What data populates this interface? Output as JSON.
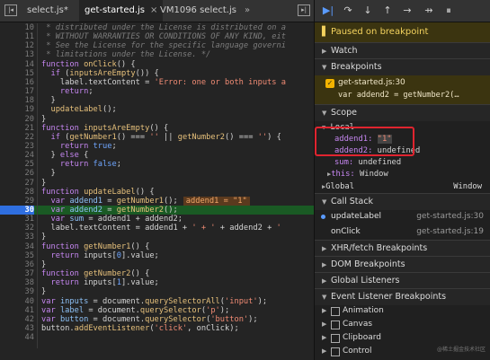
{
  "tabs": [
    {
      "label": "select.js*"
    },
    {
      "label": "get-started.js",
      "close": "×"
    },
    {
      "label": "VM1096 select.js"
    }
  ],
  "tabs_more": "»",
  "editor": {
    "lines": [
      {
        "n": "10",
        "html": "<span class='cm'> * distributed under the License is distributed on a</span>"
      },
      {
        "n": "11",
        "html": "<span class='cm'> * WITHOUT WARRANTIES OR CONDITIONS OF ANY KIND, eit</span>"
      },
      {
        "n": "12",
        "html": "<span class='cm'> * See the License for the specific language governi</span>"
      },
      {
        "n": "13",
        "html": "<span class='cm'> * limitations under the License. */</span>"
      },
      {
        "n": "14",
        "html": "<span class='kw'>function</span> <span class='fn'>onClick</span>() {"
      },
      {
        "n": "15",
        "html": "  <span class='kw'>if</span> (<span class='fn'>inputsAreEmpty</span>()) {"
      },
      {
        "n": "16",
        "html": "    label.textContent = <span class='st'>'Error: one or both inputs a</span>"
      },
      {
        "n": "17",
        "html": "    <span class='kw'>return</span>;"
      },
      {
        "n": "18",
        "html": "  }"
      },
      {
        "n": "19",
        "html": "  <span class='fn'>updateLabel</span>();"
      },
      {
        "n": "20",
        "html": "}"
      },
      {
        "n": "21",
        "html": "<span class='kw'>function</span> <span class='fn'>inputsAreEmpty</span>() {"
      },
      {
        "n": "22",
        "html": "  <span class='kw'>if</span> (<span class='fn'>getNumber1</span>() === <span class='st'>''</span> || <span class='fn'>getNumber2</span>() === <span class='st'>''</span>) {"
      },
      {
        "n": "23",
        "html": "    <span class='kw'>return</span> <span class='kw2'>true</span>;"
      },
      {
        "n": "24",
        "html": "  } <span class='kw'>else</span> {"
      },
      {
        "n": "25",
        "html": "    <span class='kw'>return</span> <span class='kw2'>false</span>;"
      },
      {
        "n": "26",
        "html": "  }"
      },
      {
        "n": "27",
        "html": "}"
      },
      {
        "n": "28",
        "html": "<span class='kw'>function</span> <span class='fn'>updateLabel</span>() {"
      },
      {
        "n": "29",
        "html": "  <span class='kw'>var</span> <span class='vr'>addend1</span> = <span class='fn'>getNumber1</span>();<span class='inl'>addend1 = \"1\"</span>"
      },
      {
        "n": "30",
        "html": "  <span class='kw'>var</span> <span class='vr'>addend2</span> = <span class='fn'>getNumber2</span>();",
        "highlight": true
      },
      {
        "n": "31",
        "html": "  <span class='kw'>var</span> <span class='vr'>sum</span> = addend1 + addend2;"
      },
      {
        "n": "32",
        "html": "  label.textContent = addend1 + <span class='st'>' + '</span> + addend2 + <span class='st'>'</span>"
      },
      {
        "n": "33",
        "html": "}"
      },
      {
        "n": "34",
        "html": "<span class='kw'>function</span> <span class='fn'>getNumber1</span>() {"
      },
      {
        "n": "35",
        "html": "  <span class='kw'>return</span> inputs[<span class='kw2'>0</span>].value;"
      },
      {
        "n": "36",
        "html": "}"
      },
      {
        "n": "37",
        "html": "<span class='kw'>function</span> <span class='fn'>getNumber2</span>() {"
      },
      {
        "n": "38",
        "html": "  <span class='kw'>return</span> inputs[<span class='kw2'>1</span>].value;"
      },
      {
        "n": "39",
        "html": "}"
      },
      {
        "n": "40",
        "html": "<span class='kw'>var</span> <span class='vr'>inputs</span> = document.<span class='fn'>querySelectorAll</span>(<span class='st'>'input'</span>);"
      },
      {
        "n": "41",
        "html": "<span class='kw'>var</span> <span class='vr'>label</span> = document.<span class='fn'>querySelector</span>(<span class='st'>'p'</span>);"
      },
      {
        "n": "42",
        "html": "<span class='kw'>var</span> <span class='vr'>button</span> = document.<span class='fn'>querySelector</span>(<span class='st'>'button'</span>);"
      },
      {
        "n": "43",
        "html": "button.<span class='fn'>addEventListener</span>(<span class='st'>'click'</span>, onClick);"
      },
      {
        "n": "44",
        "html": ""
      }
    ]
  },
  "debugger": {
    "toolbar_icons": [
      "resume-icon",
      "step-over-icon",
      "step-into-icon",
      "step-out-icon",
      "step-icon",
      "deactivate-breakpoints-icon",
      "pause-on-exceptions-icon"
    ],
    "paused_text": "Paused on breakpoint",
    "watch": "Watch",
    "breakpoints": "Breakpoints",
    "bp_file": "get-started.js:30",
    "bp_code": "var addend2 = getNumber2(…",
    "scope": "Scope",
    "local": "Local",
    "addend1_key": "addend1:",
    "addend1_val": "\"1\"",
    "addend2_key": "addend2:",
    "addend2_val": "undefined",
    "sum_key": "sum:",
    "sum_val": "undefined",
    "this_key": "this:",
    "this_val": "Window",
    "global": "Global",
    "global_val": "Window",
    "call_stack": "Call Stack",
    "cs1_name": "updateLabel",
    "cs1_file": "get-started.js:30",
    "cs2_name": "onClick",
    "cs2_file": "get-started.js:19",
    "xhr": "XHR/fetch Breakpoints",
    "dom": "DOM Breakpoints",
    "global_listeners": "Global Listeners",
    "event_listener": "Event Listener Breakpoints",
    "events": [
      "Animation",
      "Canvas",
      "Clipboard",
      "Control"
    ],
    "watermark": "@稀土掘金技术社区"
  },
  "colors": {
    "highlight_line": "#1a5a24",
    "current_line_number": "#2f6fe0",
    "paused_bg": "#3b3410",
    "annotation_box": "#e0242f"
  }
}
